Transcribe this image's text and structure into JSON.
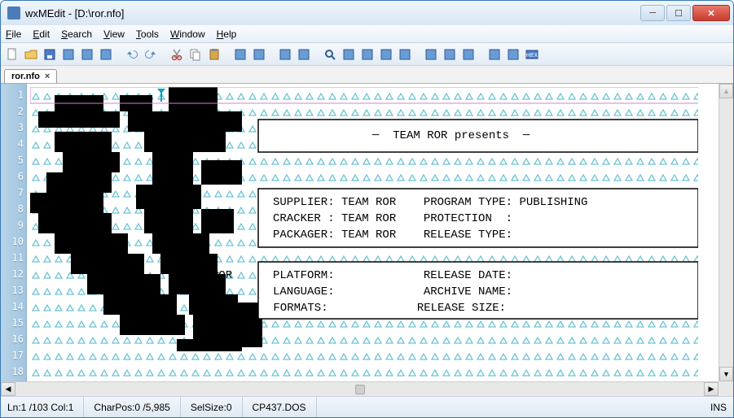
{
  "window": {
    "title": "wxMEdit - [D:\\ror.nfo]"
  },
  "menus": [
    "File",
    "Edit",
    "Search",
    "View",
    "Tools",
    "Window",
    "Help"
  ],
  "tab": {
    "name": "ror.nfo"
  },
  "status": {
    "pos": "Ln:1 /103 Col:1",
    "charpos": "CharPos:0 /5,985",
    "sel": "SelSize:0",
    "enc": "CP437.DOS",
    "mode": "INS"
  },
  "content": {
    "heading": "─  TEAM ROR presents  ─",
    "rows": [
      "SUPPLIER: TEAM ROR    PROGRAM TYPE: PUBLISHING",
      "CRACKER : TEAM ROR    PROTECTION  :",
      "PACKAGER: TEAM ROR    RELEASE TYPE:",
      "",
      "PLATFORM:             RELEASE DATE:",
      "LANGUAGE:             ARCHIVE NAME:",
      " FORMATS:             RELEASE SIZE:"
    ],
    "ror_label": "ROR"
  },
  "linecount": 18,
  "toolbar_icons": [
    "new-file",
    "open-file",
    "save-file",
    "save-all",
    "close-file",
    "close-all",
    "sep",
    "undo",
    "redo",
    "sep",
    "cut",
    "copy",
    "paste",
    "sep",
    "indent",
    "unindent",
    "sep",
    "comment",
    "uncomment",
    "sep",
    "find",
    "find-prev",
    "find-next",
    "replace",
    "goto",
    "sep",
    "left-align",
    "center-align",
    "right-align",
    "sep",
    "options",
    "columns",
    "hex-mode"
  ]
}
